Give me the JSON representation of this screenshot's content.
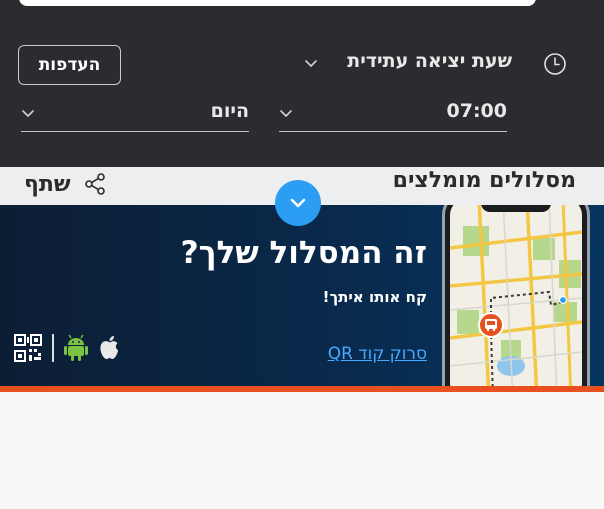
{
  "filters": {
    "departure_mode": "שעת יציאה עתידית",
    "preferences_label": "העדפות",
    "time_value": "07:00",
    "day_value": "היום"
  },
  "routes": {
    "title": "מסלולים מומלצים",
    "share_label": "שתף"
  },
  "promo": {
    "title": "זה המסלול שלך?",
    "subtitle": "קח אותו איתך!",
    "qr_link": "סרוק קוד QR"
  },
  "icons": {
    "clock": "clock-icon",
    "chevron": "chevron-down-icon",
    "share": "share-icon",
    "collapse": "chevron-down-icon",
    "apple": "apple-icon",
    "android": "android-icon",
    "qr": "qr-code-icon",
    "bus": "bus-marker-icon"
  },
  "colors": {
    "panel_bg": "#2a2c30",
    "accent_blue": "#2b9df2",
    "promo_bg": "#0a2747",
    "promo_stripe": "#e8501f",
    "link": "#46a9ff"
  }
}
